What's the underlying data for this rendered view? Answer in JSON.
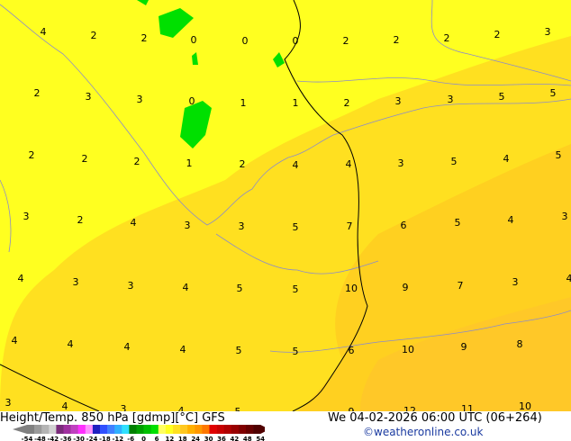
{
  "title": "Height/Temp. 850 hPa [gdmp][°C] GFS",
  "datetime": "We 04-02-2026 06:00 UTC (06+264)",
  "credit": "©weatheronline.co.uk",
  "colorbar": {
    "labels": [
      "-54",
      "-48",
      "-42",
      "-36",
      "-30",
      "-24",
      "-18",
      "-12",
      "-6",
      "0",
      "6",
      "12",
      "18",
      "24",
      "30",
      "36",
      "42",
      "48",
      "54"
    ],
    "colors": [
      "#808080",
      "#9a9a9a",
      "#b4b4b4",
      "#d2d2d2",
      "#7a2a7a",
      "#a030a0",
      "#c040c0",
      "#ff30ff",
      "#ff90ff",
      "#2020c0",
      "#3050ff",
      "#4080ff",
      "#30b0ff",
      "#30e0ff",
      "#008000",
      "#00a000",
      "#00c000",
      "#00e000",
      "#ffff60",
      "#ffff20",
      "#ffe020",
      "#ffc820",
      "#ffb000",
      "#ff9800",
      "#ff7800",
      "#e00000",
      "#c80000",
      "#b00000",
      "#980000",
      "#800000",
      "#680000",
      "#500000"
    ],
    "accent_yellow": "#ffff20",
    "accent_orange": "#ffc820"
  },
  "labels": [
    "4",
    "2",
    "2",
    "0",
    "0",
    "0",
    "2",
    "2",
    "2",
    "2",
    "3",
    "2",
    "3",
    "3",
    "0",
    "1",
    "1",
    "2",
    "3",
    "3",
    "5",
    "5",
    "2",
    "2",
    "2",
    "1",
    "2",
    "4",
    "4",
    "3",
    "5",
    "4",
    "5",
    "3",
    "2",
    "4",
    "3",
    "3",
    "5",
    "7",
    "6",
    "5",
    "4",
    "3",
    "4",
    "3",
    "3",
    "4",
    "5",
    "5",
    "10",
    "9",
    "7",
    "3",
    "4",
    "4",
    "4",
    "4",
    "4",
    "5",
    "5",
    "6",
    "10",
    "9",
    "8",
    "3",
    "4",
    "3",
    "4",
    "5",
    "9",
    "12",
    "11",
    "10"
  ]
}
